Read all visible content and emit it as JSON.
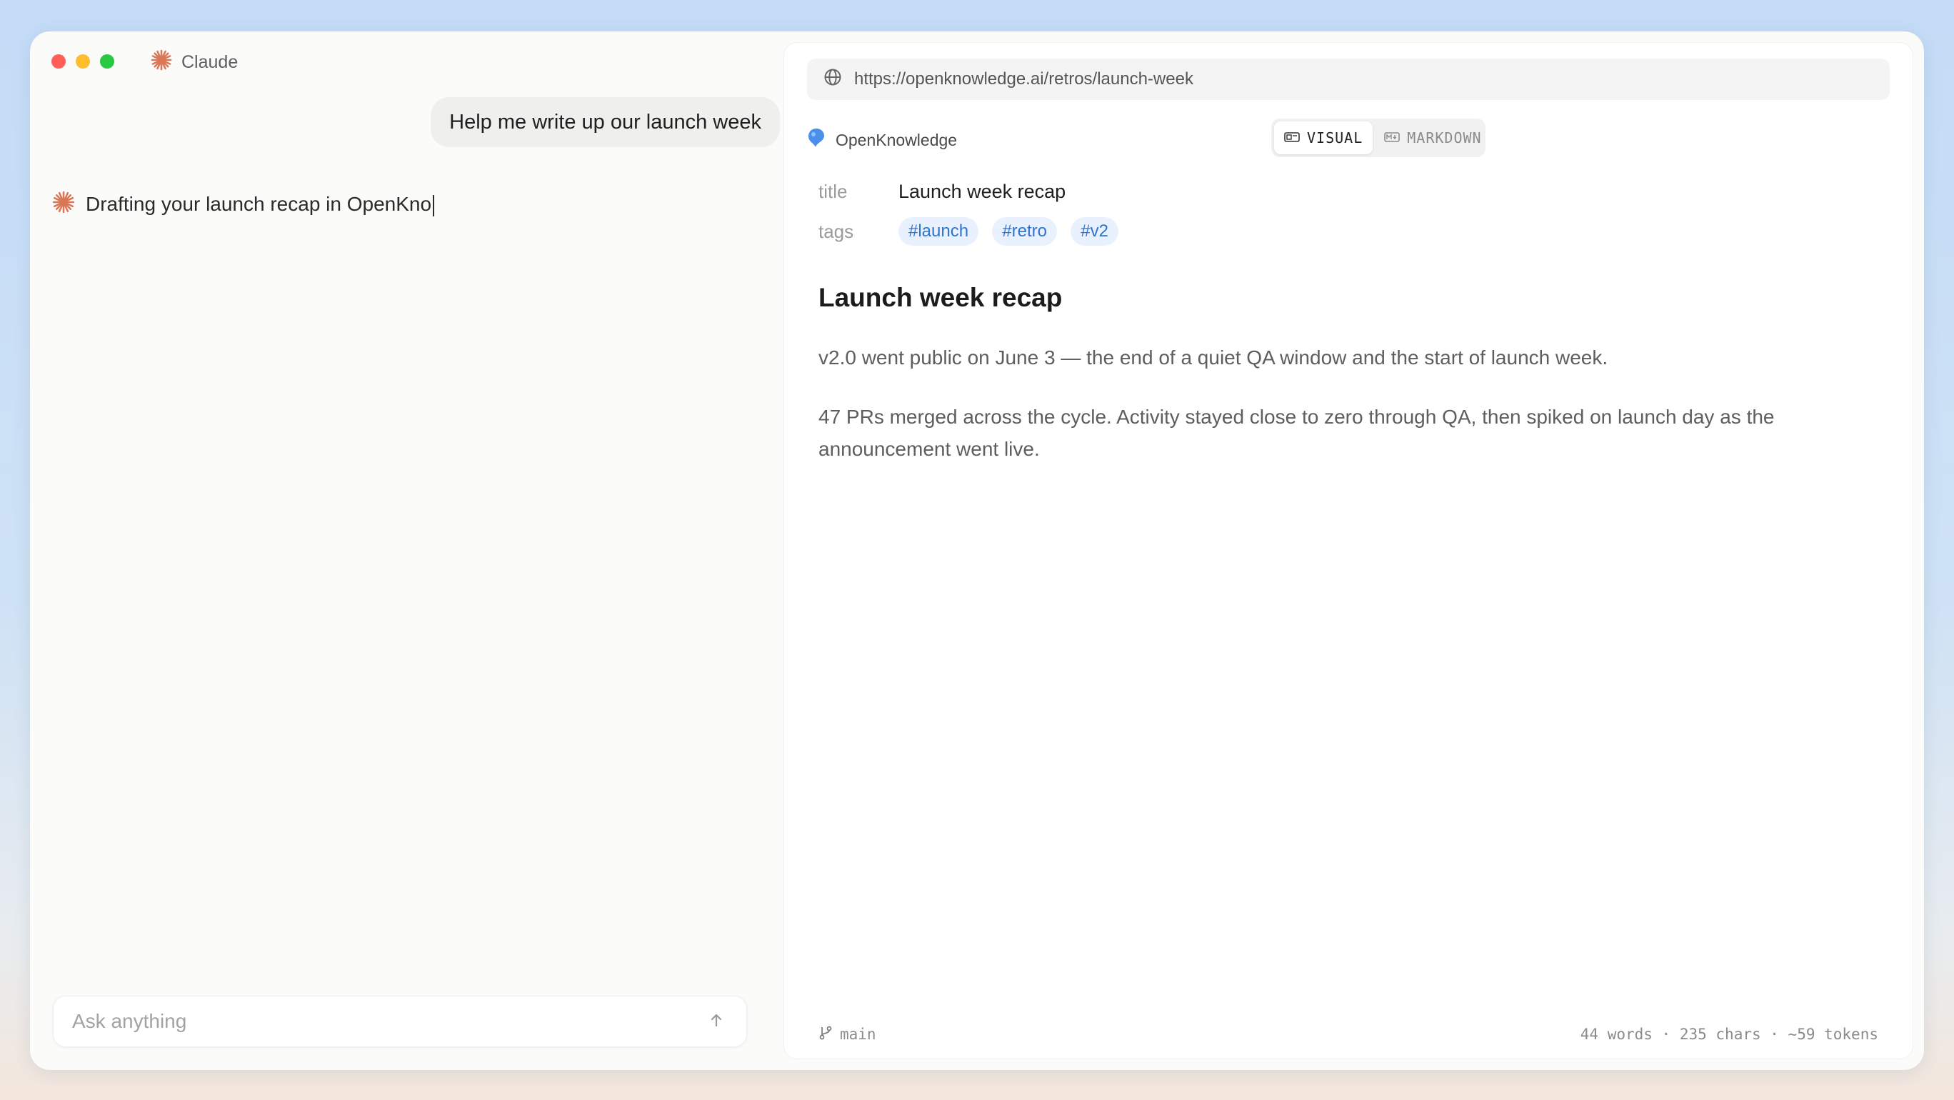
{
  "app": {
    "title": "Claude"
  },
  "chat": {
    "user_message": "Help me write up our launch week",
    "assistant_message": "Drafting your launch recap in OpenKno",
    "input": {
      "placeholder": "Ask anything",
      "value": ""
    }
  },
  "browser": {
    "url": "https://openknowledge.ai/retros/launch-week",
    "brand": "OpenKnowledge",
    "views": [
      {
        "label": "VISUAL",
        "active": true,
        "icon": "visual-icon"
      },
      {
        "label": "MARKDOWN",
        "active": false,
        "icon": "markdown-icon"
      }
    ]
  },
  "document": {
    "frontmatter": {
      "title_key": "title",
      "title_value": "Launch week recap",
      "tags_key": "tags",
      "tags": [
        "#launch",
        "#retro",
        "#v2"
      ]
    },
    "heading": "Launch week recap",
    "paragraphs": [
      "v2.0 went public on June 3 — the end of a quiet QA window and the start of launch week.",
      "47 PRs merged across the cycle. Activity stayed close to zero through QA, then spiked on launch day as the announcement went live."
    ]
  },
  "status": {
    "branch": "main",
    "stats": "44 words · 235 chars · ~59 tokens"
  },
  "colors": {
    "accent_orange": "#d97757",
    "tag_blue": "#2f74d0",
    "brand_blue": "#4a8fe8"
  }
}
